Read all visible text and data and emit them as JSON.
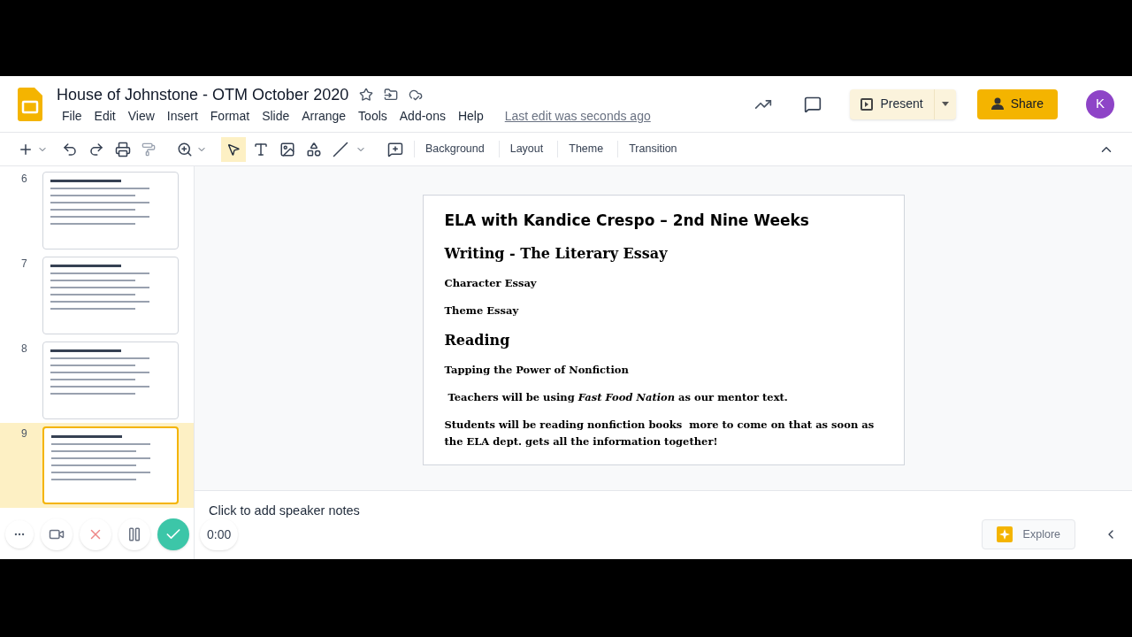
{
  "document": {
    "title": "House of Johnstone - OTM October 2020",
    "last_edit": "Last edit was seconds ago"
  },
  "menu": [
    "File",
    "Edit",
    "View",
    "Insert",
    "Format",
    "Slide",
    "Arrange",
    "Tools",
    "Add-ons",
    "Help"
  ],
  "header_buttons": {
    "present": "Present",
    "share": "Share",
    "avatar": "K"
  },
  "toolbar": {
    "buttons": [
      "Background",
      "Layout",
      "Theme",
      "Transition"
    ]
  },
  "slides": [
    {
      "number": "6",
      "selected": false
    },
    {
      "number": "7",
      "selected": false
    },
    {
      "number": "8",
      "selected": false
    },
    {
      "number": "9",
      "selected": true
    }
  ],
  "slide": {
    "paragraphs": [
      {
        "kind": "title",
        "text": "ELA with Kandice Crespo – 2nd Nine Weeks"
      },
      {
        "kind": "heading",
        "text": "Writing - The Literary Essay"
      },
      {
        "kind": "body",
        "text": "Character Essay"
      },
      {
        "kind": "body",
        "text": "Theme Essay"
      },
      {
        "kind": "heading",
        "text": "Reading"
      },
      {
        "kind": "body",
        "text": "Tapping the Power of Nonfiction"
      },
      {
        "kind": "body",
        "text": " Teachers will be using *Fast Food Nation* as our mentor text."
      },
      {
        "kind": "body",
        "text": "Students will be reading nonfiction books  more to come on that as soon as the ELA dept. gets all the information together!"
      }
    ]
  },
  "speaker_notes": {
    "placeholder": "Click to add speaker notes"
  },
  "explore": "Explore",
  "recorder": {
    "time": "0:00"
  }
}
